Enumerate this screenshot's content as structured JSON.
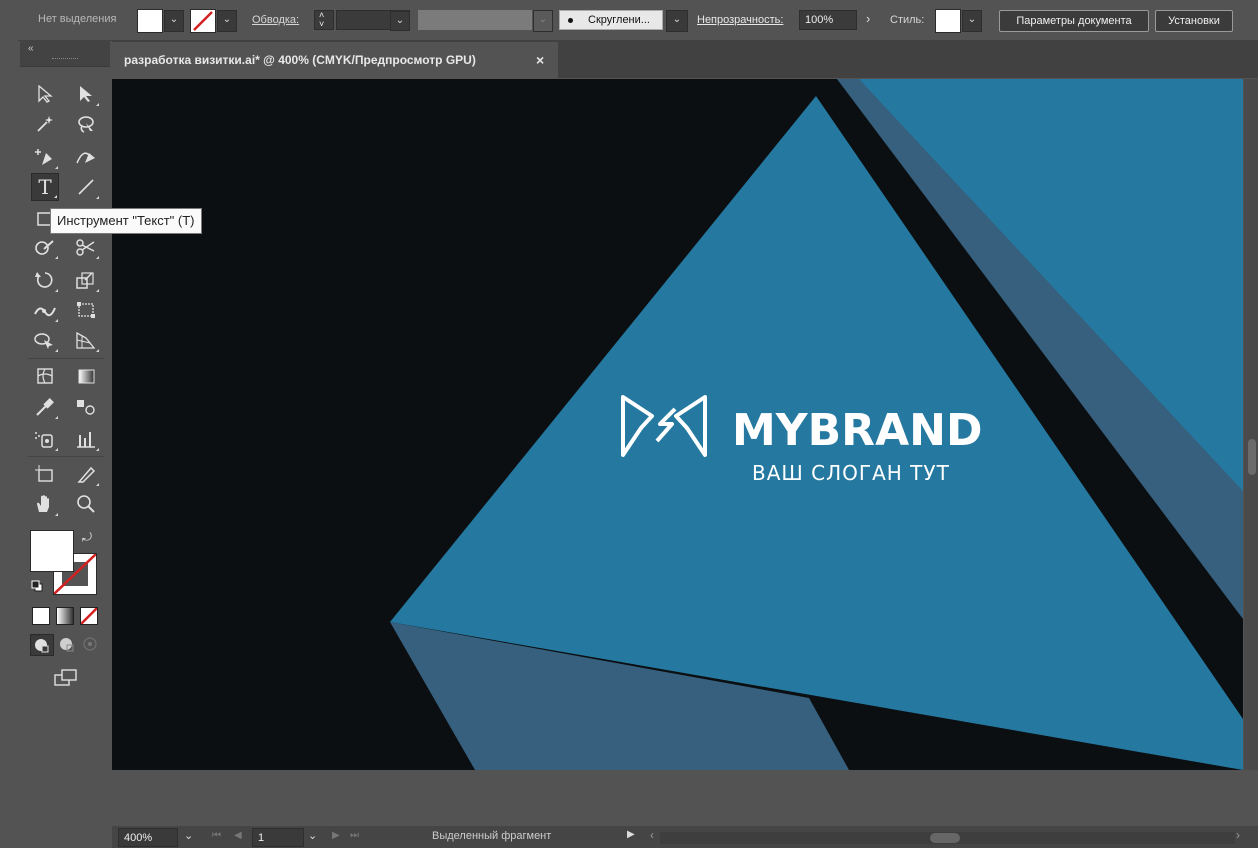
{
  "control_bar": {
    "selection_label": "Нет выделения",
    "stroke_label": "Обводка:",
    "brush_label": "Скруглени...",
    "opacity_label": "Непрозрачность:",
    "opacity_value": "100%",
    "style_label": "Стиль:",
    "doc_settings_button": "Параметры документа",
    "preferences_button": "Установки"
  },
  "toolbar": {
    "collapse_glyph": "«",
    "tooltip": "Инструмент \"Текст\" (T)",
    "active_tool": "type-tool",
    "fill_color": "#ffffff",
    "stroke_color": "none"
  },
  "document": {
    "tab_title": "разработка визитки.ai* @ 400% (CMYK/Предпросмотр GPU)",
    "close_glyph": "×"
  },
  "artwork": {
    "brand_name": "MYBRAND",
    "slogan": "ВАШ СЛОГАН ТУТ",
    "background_color": "#0b0f12",
    "primary_blue": "#2579a0",
    "secondary_blue": "#36607e"
  },
  "status_bar": {
    "zoom": "400%",
    "artboard_number": "1",
    "status_text": "Выделенный фрагмент"
  }
}
